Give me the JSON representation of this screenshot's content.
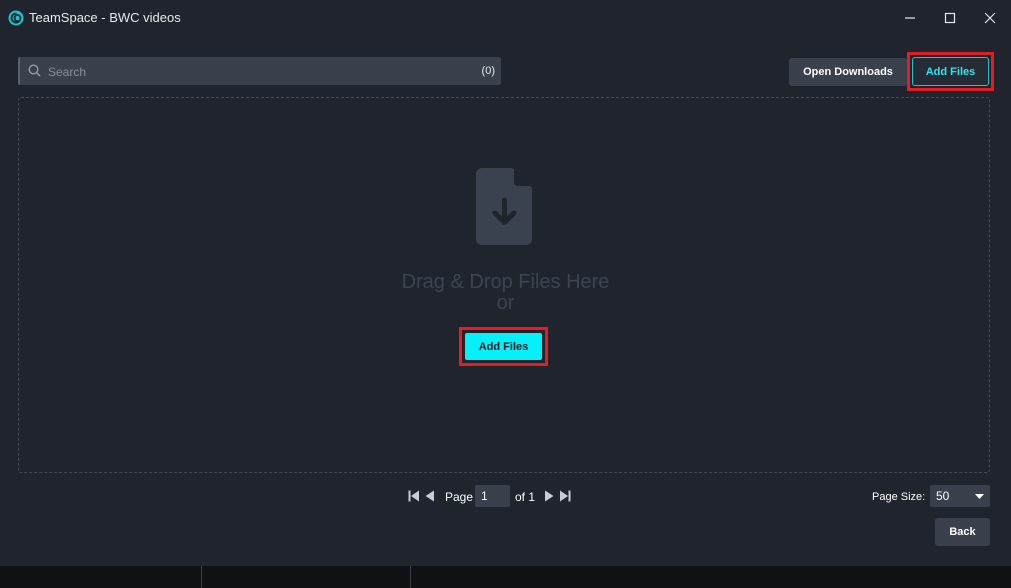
{
  "window": {
    "title": "TeamSpace - BWC videos",
    "controls": [
      "minimize-icon",
      "maximize-icon",
      "close-icon"
    ]
  },
  "search": {
    "placeholder": "Search",
    "value": "",
    "count": "(0)"
  },
  "toolbar": {
    "open_downloads_label": "Open Downloads",
    "add_files_label": "Add Files"
  },
  "dropzone": {
    "icon": "file-download-icon",
    "line1": "Drag & Drop Files Here",
    "line2": "or",
    "add_files_label": "Add Files"
  },
  "pagination": {
    "page_label": "Page",
    "current_page": "1",
    "of_label": "of 1",
    "page_size_label": "Page Size:",
    "page_size_value": "50"
  },
  "footer": {
    "back_label": "Back"
  },
  "colors": {
    "background": "#20252d",
    "accent": "#06f0f9",
    "highlight": "#e11d26"
  }
}
